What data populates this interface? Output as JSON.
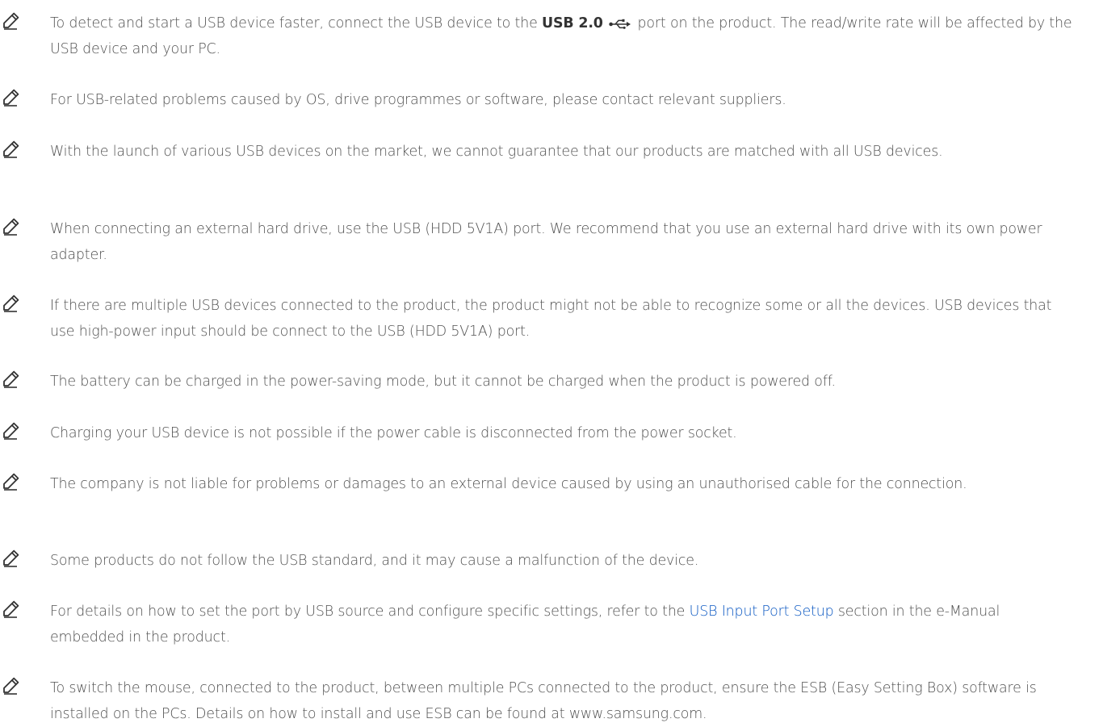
{
  "colors": {
    "text": "#505050",
    "link": "#0a57c2",
    "icon": "#333333"
  },
  "icons": {
    "note": "pencil-note-icon",
    "usb": "usb-symbol-icon"
  },
  "notes": [
    {
      "before": "To detect and start a USB device faster, connect the USB device to the ",
      "port_label": "USB 2.0",
      "after": " port on the product. The read/write rate will be affected by the USB device and your PC."
    },
    {
      "text": "For USB-related problems caused by OS, drive programmes or software, please contact relevant suppliers."
    },
    {
      "text": "With the launch of various USB devices on the market, we cannot guarantee that our products are matched with all USB devices."
    },
    {
      "text": "When connecting an external hard drive, use the USB (HDD 5V1A) port. We recommend that you use an external hard drive with its own power adapter."
    },
    {
      "text": "If there are multiple USB devices connected to the product, the product might not be able to recognize some or all the devices. USB devices that use high-power input should be connect to the USB (HDD 5V1A) port."
    },
    {
      "text": "The battery can be charged in the power-saving mode, but it cannot be charged when the product is powered off."
    },
    {
      "text": "Charging your USB device is not possible if the power cable is disconnected from the power socket."
    },
    {
      "text": "The company is not liable for problems or damages to an external device caused by using an unauthorised cable for the connection."
    },
    {
      "text": "Some products do not follow the USB standard, and it may cause a malfunction of the device."
    },
    {
      "before": "For details on how to set the port by USB source and configure specific settings, refer to the ",
      "link": "USB Input Port Setup",
      "after": " section in the e-Manual embedded in the product."
    },
    {
      "text": "To switch the mouse, connected to the product, between multiple PCs connected to the product, ensure the ESB (Easy Setting Box) software is installed on the PCs. Details on how to install and use ESB can be found at www.samsung.com."
    }
  ]
}
